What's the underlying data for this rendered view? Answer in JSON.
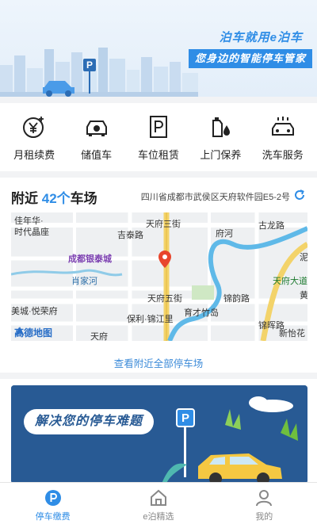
{
  "banner": {
    "slogan_main": "泊车就用e泊车",
    "slogan_sub": "您身边的智能停车管家",
    "parking_sign": "P"
  },
  "services": [
    {
      "label": "月租续费",
      "icon": "yen-renew-icon"
    },
    {
      "label": "储值车",
      "icon": "stored-value-car-icon"
    },
    {
      "label": "车位租赁",
      "icon": "parking-space-rent-icon"
    },
    {
      "label": "上门保养",
      "icon": "oil-maintenance-icon"
    },
    {
      "label": "洗车服务",
      "icon": "car-wash-icon"
    }
  ],
  "nearby": {
    "prefix": "附近",
    "count": "42个",
    "suffix": "车场",
    "address": "四川省成都市武侯区天府软件园E5-2号",
    "view_all": "查看附近全部停车场"
  },
  "map": {
    "labels": [
      "佳年华·",
      "时代晶座",
      "天府三街",
      "古龙路",
      "成都银泰城",
      "肖家河",
      "天府五街",
      "锦韵路",
      "天府大道",
      "美城·悦荣府",
      "保利·锦江里",
      "育才竹岛",
      "新怡花",
      "吉泰路",
      "府河",
      "锦晖路",
      "天府",
      "黄",
      "泥"
    ],
    "logo_text": "高德地图",
    "pin_color": "#e8452c"
  },
  "promo": {
    "title": "解决您的停车难题",
    "sign": "P"
  },
  "tabs": [
    {
      "label": "停车缴费",
      "active": true
    },
    {
      "label": "e泊精选",
      "active": false
    },
    {
      "label": "我的",
      "active": false
    }
  ],
  "colors": {
    "accent": "#2f8de6",
    "promo_bg": "#285a94"
  }
}
